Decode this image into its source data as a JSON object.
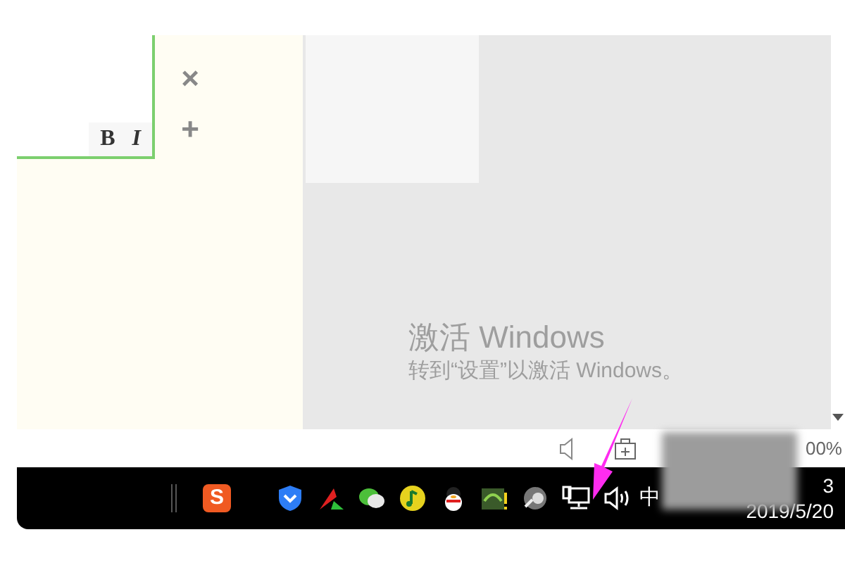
{
  "editor": {
    "toolbar": [
      {
        "label": "B",
        "kind": "bold"
      },
      {
        "label": "I",
        "kind": "italic"
      }
    ]
  },
  "side_buttons": [
    "×",
    "+"
  ],
  "activation_notice": {
    "title": "激活 Windows",
    "subtitle": "转到“设置”以激活 Windows。"
  },
  "status_bar": {
    "zoom": "00%"
  },
  "taskbar": {
    "pinned": {
      "kind": "sogou",
      "label": "S"
    },
    "tray_icons": [
      {
        "kind": "shield"
      },
      {
        "kind": "red-arrow"
      },
      {
        "kind": "chat"
      },
      {
        "kind": "music"
      },
      {
        "kind": "penguin"
      },
      {
        "kind": "gpu"
      },
      {
        "kind": "speaker-ball"
      },
      {
        "kind": "network"
      },
      {
        "kind": "volume"
      }
    ],
    "ime": "中",
    "time": "3",
    "date": "2019/5/20"
  }
}
